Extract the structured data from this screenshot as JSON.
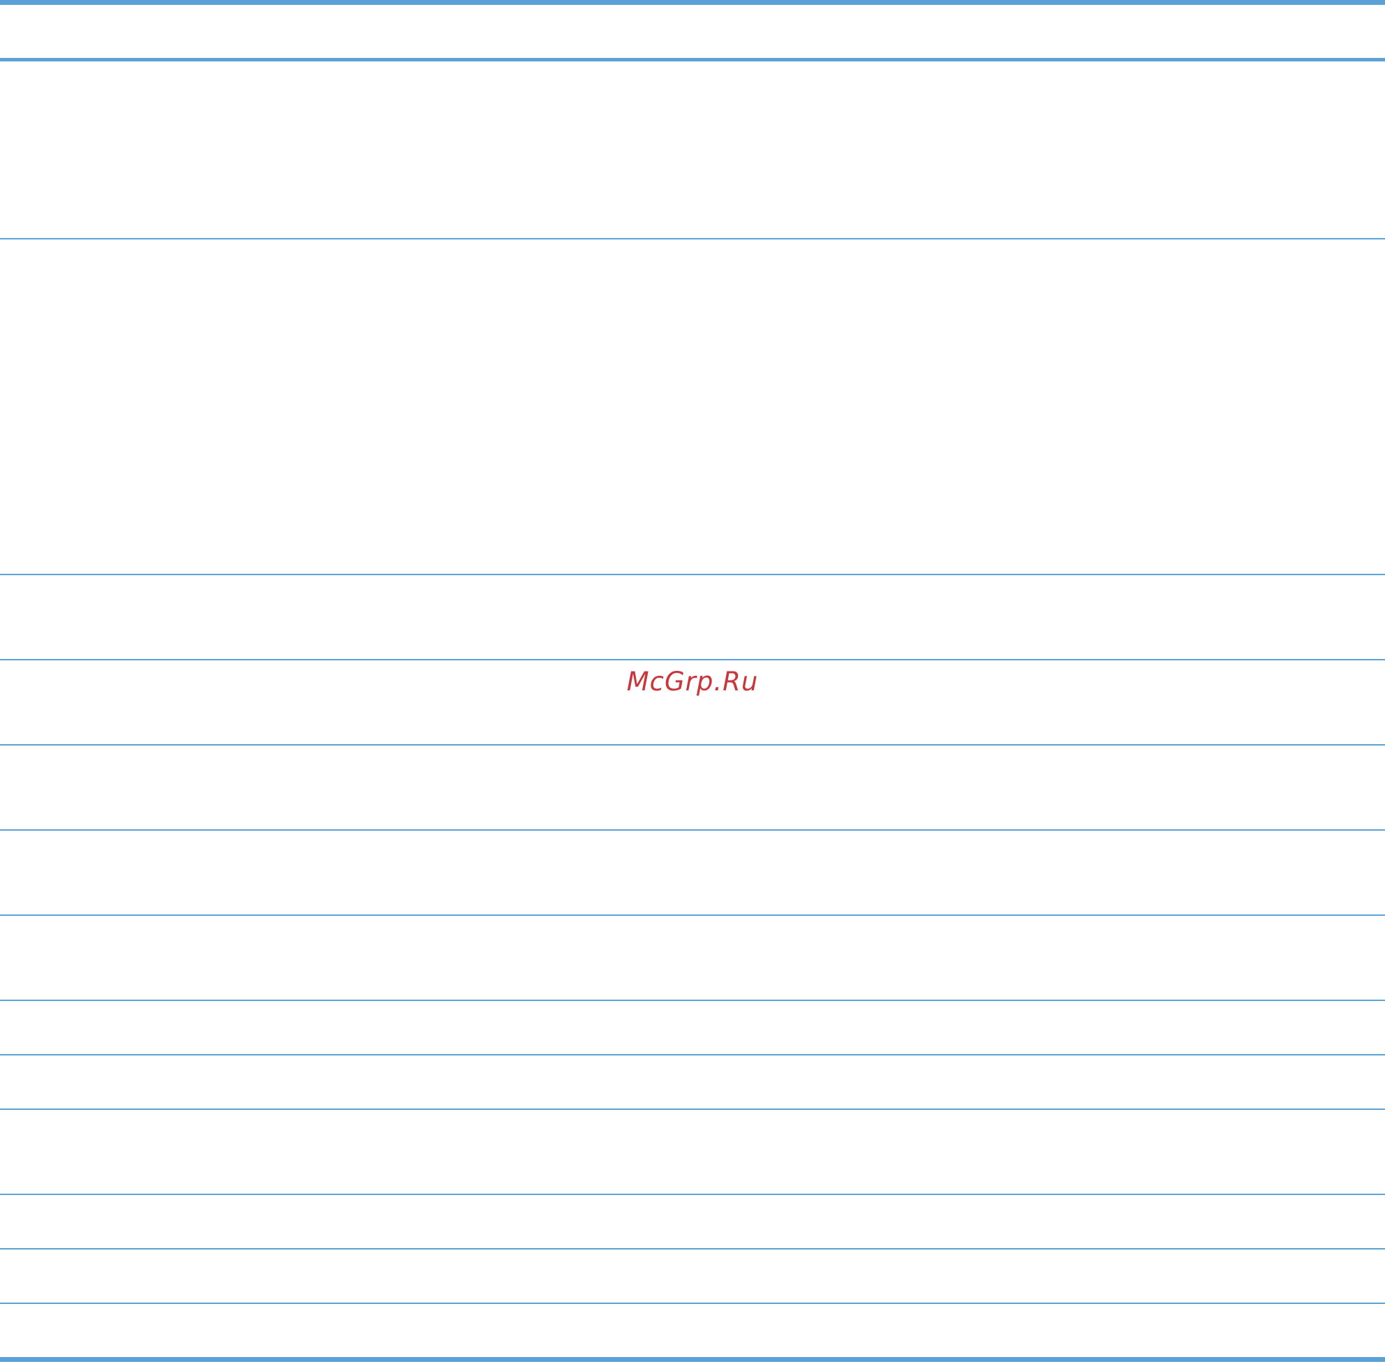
{
  "watermark": {
    "text": "McGrp.Ru"
  },
  "colors": {
    "rule": "#5ba3d6",
    "watermark": "#c8353a",
    "background": "#ffffff"
  },
  "table": {
    "header": "",
    "rows": [
      "",
      "",
      "",
      "",
      "",
      "",
      "",
      "",
      "",
      "",
      "",
      "",
      "",
      ""
    ]
  }
}
